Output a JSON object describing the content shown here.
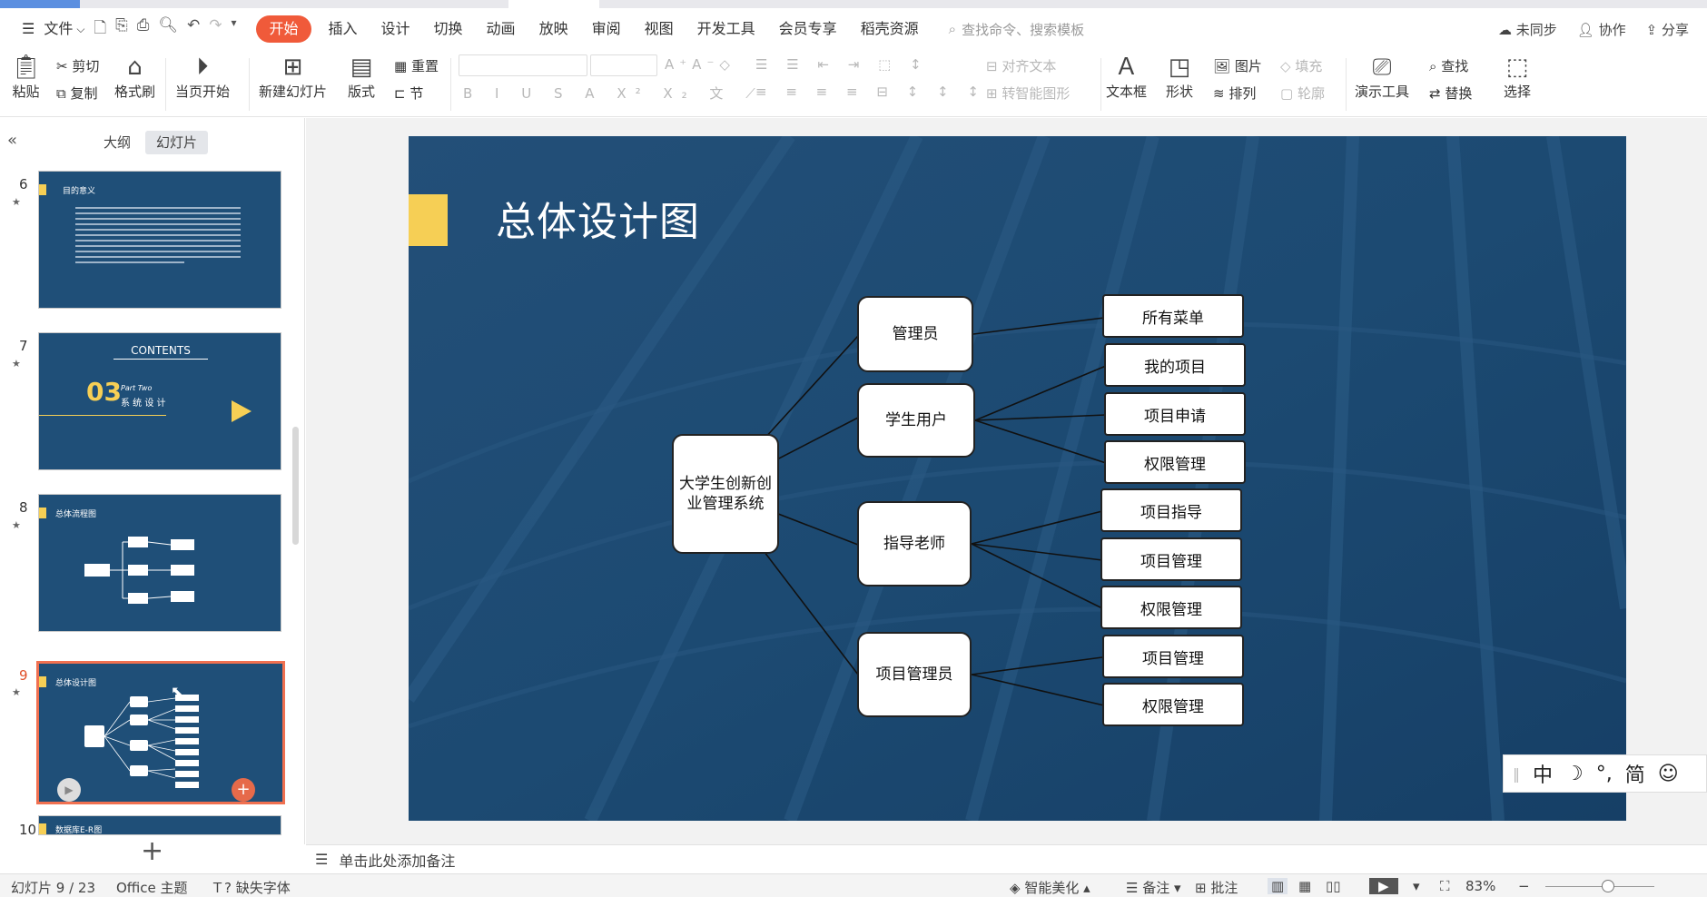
{
  "menu": {
    "file": "文件",
    "items": [
      "开始",
      "插入",
      "设计",
      "切换",
      "动画",
      "放映",
      "审阅",
      "视图",
      "开发工具",
      "会员专享",
      "稻壳资源"
    ],
    "search_placeholder": "查找命令、搜索模板",
    "right": {
      "sync": "未同步",
      "collab": "协作",
      "share": "分享"
    }
  },
  "ribbon": {
    "paste": "粘贴",
    "cut": "剪切",
    "copy": "复制",
    "format_painter": "格式刷",
    "from_current": "当页开始",
    "new_slide": "新建幻灯片",
    "layout": "版式",
    "reset": "重置",
    "section": "节",
    "align_text": "对齐文本",
    "smart_art": "转智能图形",
    "textbox": "文本框",
    "shape": "形状",
    "picture": "图片",
    "fill": "填充",
    "arrange": "排列",
    "outline": "轮廓",
    "present_tool": "演示工具",
    "find": "查找",
    "replace": "替换",
    "select": "选择"
  },
  "sidebar": {
    "tab_outline": "大纲",
    "tab_slides": "幻灯片",
    "slides": [
      {
        "num": "6",
        "title": "目的意义"
      },
      {
        "num": "7",
        "contents": "CONTENTS",
        "big": "03",
        "part": "Part Two",
        "sub": "系 统 设 计"
      },
      {
        "num": "8",
        "title": "总体流程图"
      },
      {
        "num": "9",
        "title": "总体设计图"
      },
      {
        "num": "10",
        "title": "数据库E-R图"
      }
    ]
  },
  "slide": {
    "title": "总体设计图",
    "root": "大学生创新创业管理系统",
    "roles": [
      "管理员",
      "学生用户",
      "指导老师",
      "项目管理员"
    ],
    "leaves": {
      "admin": [
        "所有菜单"
      ],
      "student": [
        "我的项目",
        "项目申请",
        "权限管理"
      ],
      "teacher": [
        "项目指导",
        "项目管理",
        "权限管理"
      ],
      "pm": [
        "项目管理",
        "权限管理"
      ]
    }
  },
  "ime": {
    "lang": "中",
    "moon": "☽",
    "punct": "°,",
    "simp": "简",
    "emoji": "☺"
  },
  "notes_hint": "单击此处添加备注",
  "status": {
    "slide_pos": "幻灯片 9 / 23",
    "theme": "Office 主题",
    "missing_font": "缺失字体",
    "beautify": "智能美化",
    "notes": "备注",
    "comment": "批注",
    "zoom": "83%"
  },
  "colors": {
    "accent": "#f05a3a",
    "slide_bg": "#1b4a73",
    "yellow": "#f6cf55",
    "current_border": "#f07050"
  }
}
